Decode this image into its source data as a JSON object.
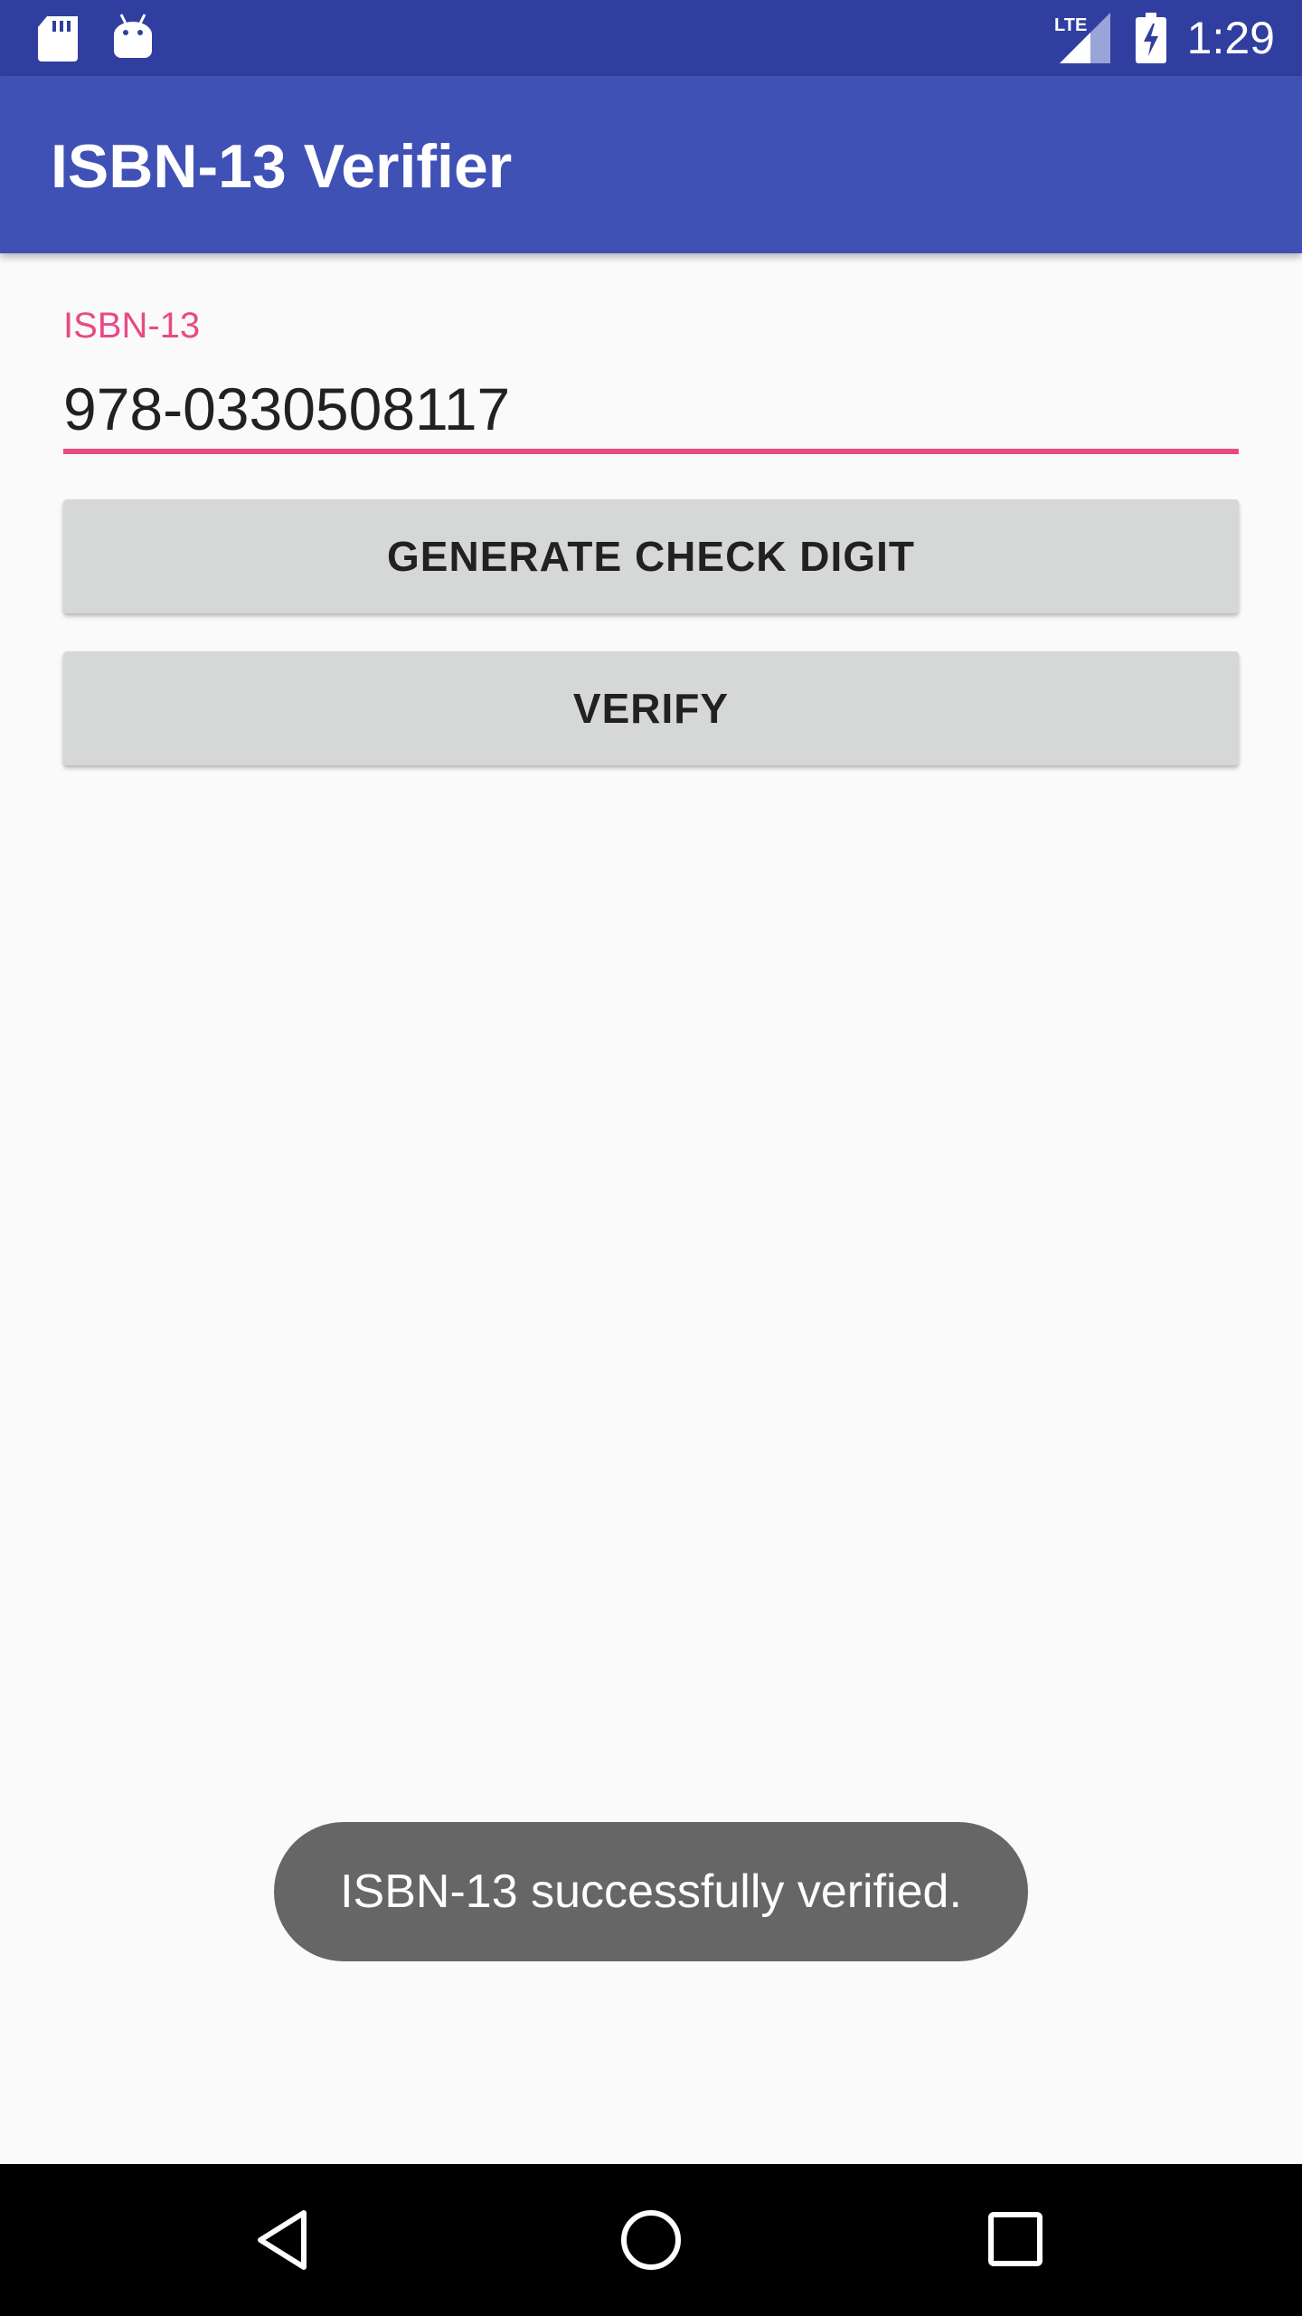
{
  "status_bar": {
    "time": "1:29",
    "network": "LTE",
    "icons": [
      "sd-card-icon",
      "android-debug-icon",
      "lte-signal-icon",
      "battery-charging-icon"
    ]
  },
  "app_bar": {
    "title": "ISBN-13 Verifier"
  },
  "form": {
    "isbn_label": "ISBN-13",
    "isbn_value": "978-0330508117"
  },
  "buttons": {
    "generate_label": "GENERATE CHECK DIGIT",
    "verify_label": "VERIFY"
  },
  "toast": {
    "message": "ISBN-13 successfully verified."
  },
  "nav_bar": {
    "icons": [
      "back-icon",
      "home-icon",
      "recents-icon"
    ]
  },
  "colors": {
    "status_bar": "#303f9f",
    "app_bar": "#3f51b5",
    "accent": "#e84a84",
    "button": "#d6d7d7",
    "toast": "#666666"
  }
}
